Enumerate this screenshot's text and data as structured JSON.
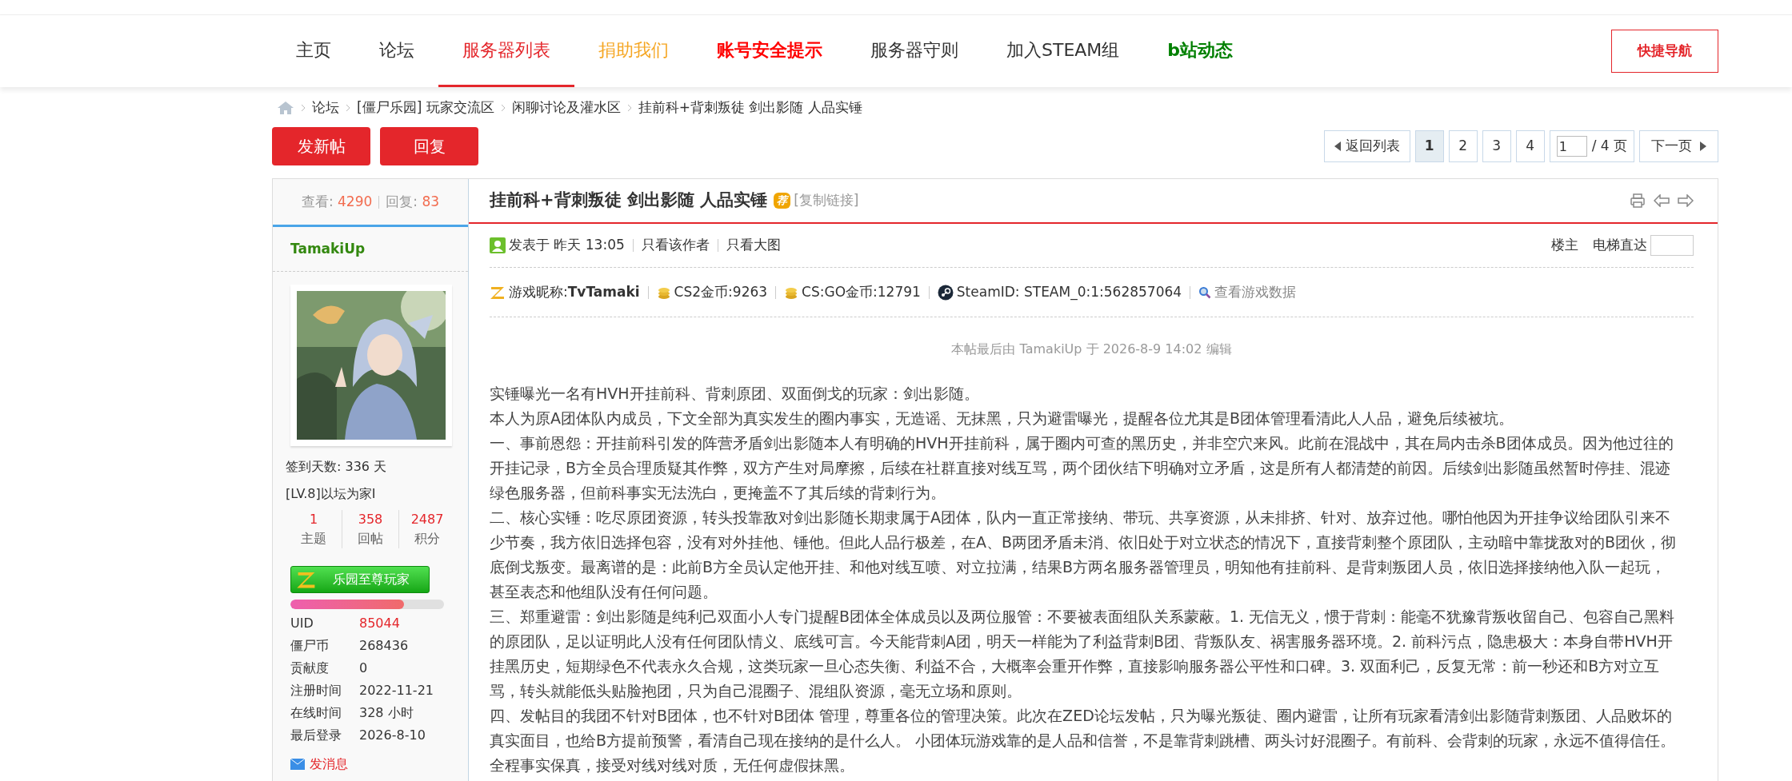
{
  "nav": {
    "items": [
      {
        "label": "主页",
        "selected": false,
        "color": "#333333",
        "bold": false
      },
      {
        "label": "论坛",
        "selected": false,
        "color": "#333333",
        "bold": false
      },
      {
        "label": "服务器列表",
        "selected": true,
        "color": "#e4262b",
        "bold": false
      },
      {
        "label": "捐助我们",
        "selected": false,
        "color": "#f5a623",
        "bold": false
      },
      {
        "label": "账号安全提示",
        "selected": false,
        "color": "#ff0000",
        "bold": true
      },
      {
        "label": "服务器守则",
        "selected": false,
        "color": "#333333",
        "bold": false
      },
      {
        "label": "加入STEAM组",
        "selected": false,
        "color": "#333333",
        "bold": false
      },
      {
        "label": "b站动态",
        "selected": false,
        "color": "#008000",
        "bold": true
      }
    ],
    "quick_nav": "快捷导航"
  },
  "breadcrumb": [
    "论坛",
    "[僵尸乐园] 玩家交流区",
    "闲聊讨论及灌水区",
    "挂前科+背刺叛徒 剑出影随 人品实锤"
  ],
  "actions": [
    "发新帖",
    "回复"
  ],
  "pagination": {
    "back": "返回列表",
    "pages": [
      {
        "label": "1",
        "selected": true
      },
      {
        "label": "2",
        "selected": false
      },
      {
        "label": "3",
        "selected": false
      },
      {
        "label": "4",
        "selected": false
      }
    ],
    "page_value": "1",
    "total": "/ 4 页",
    "next": "下一页"
  },
  "sidebar": {
    "views_label": "查看:",
    "views": "4290",
    "replies_label": "回复:",
    "replies": "83",
    "username": "TamakiUp",
    "checkin": "签到天数: 336 天",
    "rank": "[LV.8]以坛为家I",
    "counts": [
      {
        "value": "1",
        "label": "主题"
      },
      {
        "value": "358",
        "label": "回帖"
      },
      {
        "value": "2487",
        "label": "积分"
      }
    ],
    "medal": "乐园至尊玩家",
    "progress": {
      "level": 0.74
    },
    "profile": [
      {
        "label": "UID",
        "value": "85044",
        "highlight": true
      },
      {
        "label": "僵尸币",
        "value": "268436",
        "highlight": false
      },
      {
        "label": "贡献度",
        "value": "0",
        "highlight": false
      },
      {
        "label": "注册时间",
        "value": "2022-11-21",
        "highlight": false
      },
      {
        "label": "在线时间",
        "value": "328 小时",
        "highlight": false
      },
      {
        "label": "最后登录",
        "value": "2026-8-10",
        "highlight": false
      }
    ],
    "message_link": "发消息"
  },
  "post": {
    "title": "挂前科+背刺叛徒 剑出影随 人品实锤",
    "badge": "荐",
    "copy_link": "[复制链接]",
    "meta": {
      "posted": "发表于 昨天 13:05",
      "links": [
        "只看该作者",
        "只看大图"
      ],
      "floor": "楼主",
      "jump_label": "电梯直达"
    },
    "game_info": [
      {
        "kind": "nickname",
        "text": "游戏昵称:**TvTamaki**"
      },
      {
        "kind": "coin",
        "text": "CS2金币:9263"
      },
      {
        "kind": "coin",
        "text": "CS:GO金币:12791"
      },
      {
        "kind": "steam",
        "text": "SteamID: STEAM_0:1:562857064"
      },
      {
        "kind": "search",
        "text": "查看游戏数据"
      }
    ],
    "edit_note": "本帖最后由 TamakiUp 于 2026-8-9 14:02 编辑",
    "paragraphs": [
      "实锤曝光一名有HVH开挂前科、背刺原团、双面倒戈的玩家：剑出影随。",
      "本人为原A团体队内成员，下文全部为真实发生的圈内事实，无造谣、无抹黑，只为避雷曝光，提醒各位尤其是B团体管理看清此人人品，避免后续被坑。",
      "一、事前恩怨：开挂前科引发的阵营矛盾剑出影随本人有明确的HVH开挂前科，属于圈内可查的黑历史，并非空穴来风。此前在混战中，其在局内击杀B团体成员。因为他过往的开挂记录，B方全员合理质疑其作弊，双方产生对局摩擦，后续在社群直接对线互骂，两个团伙结下明确对立矛盾，这是所有人都清楚的前因。后续剑出影随虽然暂时停挂、混迹绿色服务器，但前科事实无法洗白，更掩盖不了其后续的背刺行为。",
      "二、核心实锤：吃尽原团资源，转头投靠敌对剑出影随长期隶属于A团体，队内一直正常接纳、带玩、共享资源，从未排挤、针对、放弃过他。哪怕他因为开挂争议给团队引来不少节奏，我方依旧选择包容，没有对外挂他、锤他。但此人品行极差，在A、B两团矛盾未消、依旧处于对立状态的情况下，直接背刺整个原团队，主动暗中靠拢敌对的B团伙，彻底倒戈叛变。最离谱的是：此前B方全员认定他开挂、和他对线互喷、对立拉满，结果B方两名服务器管理员，明知他有挂前科、是背刺叛团人员，依旧选择接纳他入队一起玩，甚至表态和他组队没有任何问题。",
      "三、郑重避雷：剑出影随是纯利己双面小人专门提醒B团体全体成员以及两位服管：不要被表面组队关系蒙蔽。1. 无信无义，惯于背刺：能毫不犹豫背叛收留自己、包容自己黑料的原团队，足以证明此人没有任何团队情义、底线可言。今天能背刺A团，明天一样能为了利益背刺B团、背叛队友、祸害服务器环境。2. 前科污点，隐患极大：本身自带HVH开挂黑历史，短期绿色不代表永久合规，这类玩家一旦心态失衡、利益不合，大概率会重开作弊，直接影响服务器公平性和口碑。3. 双面利己，反复无常：前一秒还和B方对立互骂，转头就能低头贴脸抱团，只为自己混圈子、混组队资源，毫无立场和原则。",
      "四、发帖目的我团不针对B团体，也不针对B团体 管理，尊重各位的管理决策。此次在ZED论坛发帖，只为曝光叛徒、圈内避雷，让所有玩家看清剑出影随背刺叛团、人品败坏的真实面目，也给B方提前预警，看清自己现在接纳的是什么人。 小团体玩游戏靠的是人品和信誉，不是靠背刺跳槽、两头讨好混圈子。有前科、会背刺的玩家，永远不值得信任。全程事实保真，接受对线对线对质，无任何虚假抹黑。"
    ]
  }
}
